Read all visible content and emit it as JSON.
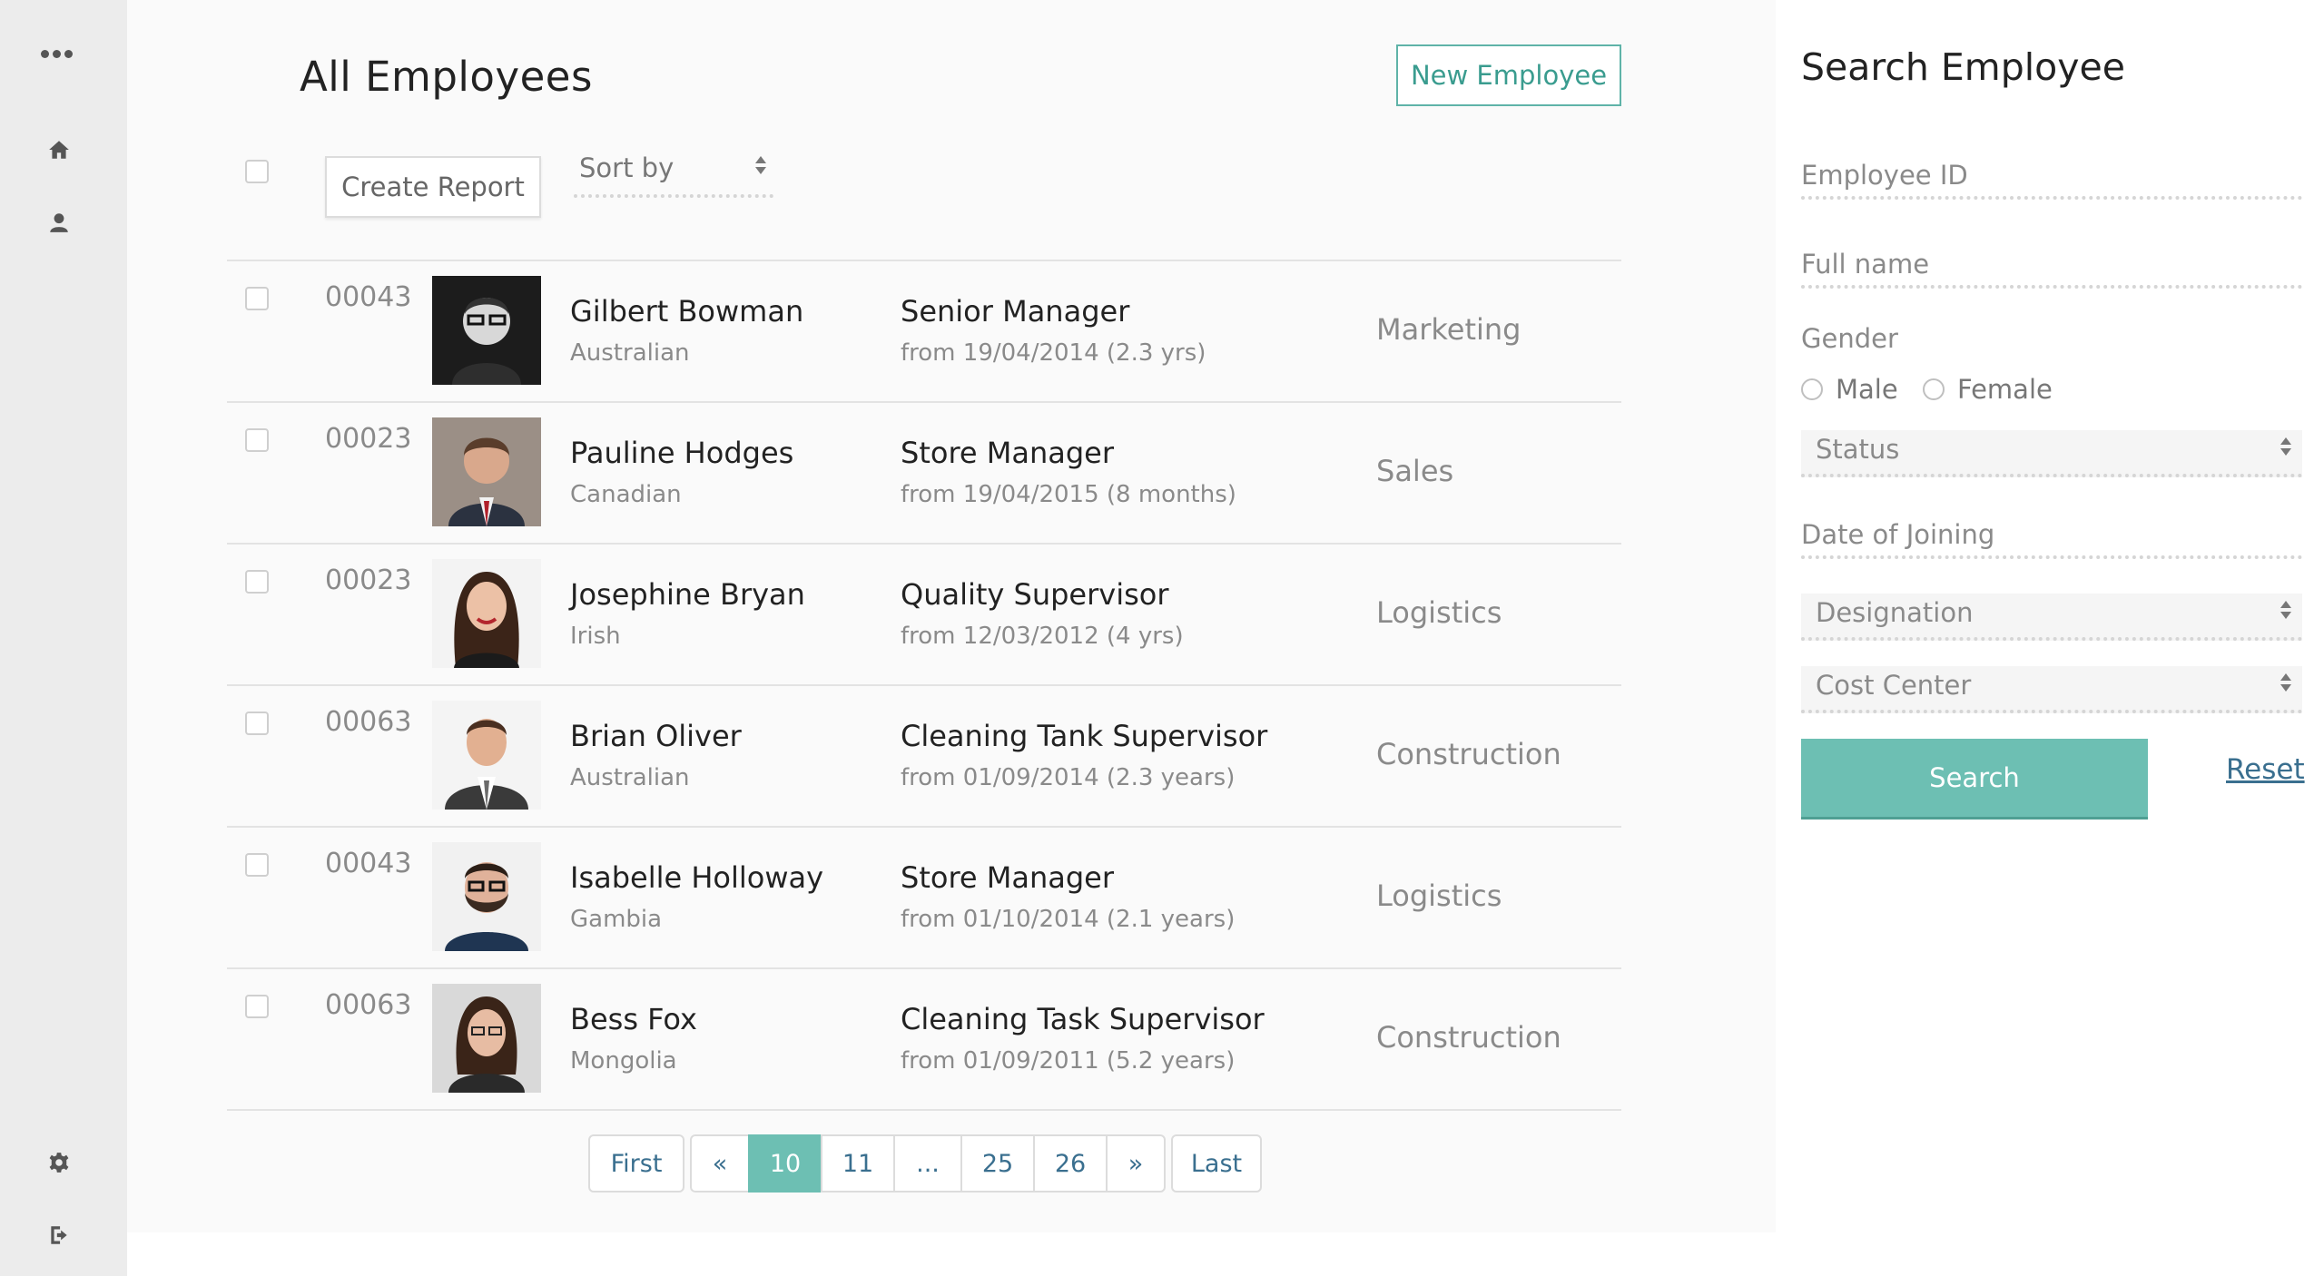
{
  "sidebar": {
    "icons": [
      "more-icon",
      "home-icon",
      "user-icon",
      "gear-icon",
      "logout-icon"
    ]
  },
  "header": {
    "title": "All Employees",
    "new_employee_label": "New Employee",
    "create_report_label": "Create Report",
    "sort_by_label": "Sort by"
  },
  "employees": [
    {
      "id": "00043",
      "name": "Gilbert Bowman",
      "nationality": "Australian",
      "role": "Senior Manager",
      "since": "from 19/04/2014 (2.3 yrs)",
      "department": "Marketing"
    },
    {
      "id": "00023",
      "name": "Pauline Hodges",
      "nationality": "Canadian",
      "role": "Store Manager",
      "since": "from 19/04/2015 (8 months)",
      "department": "Sales"
    },
    {
      "id": "00023",
      "name": "Josephine Bryan",
      "nationality": "Irish",
      "role": "Quality Supervisor",
      "since": "from 12/03/2012 (4 yrs)",
      "department": "Logistics"
    },
    {
      "id": "00063",
      "name": "Brian Oliver",
      "nationality": "Australian",
      "role": "Cleaning Tank Supervisor",
      "since": "from 01/09/2014 (2.3 years)",
      "department": "Construction"
    },
    {
      "id": "00043",
      "name": "Isabelle Holloway",
      "nationality": "Gambia",
      "role": "Store Manager",
      "since": "from 01/10/2014 (2.1 years)",
      "department": "Logistics"
    },
    {
      "id": "00063",
      "name": "Bess Fox",
      "nationality": "Mongolia",
      "role": "Cleaning Task Supervisor",
      "since": "from 01/09/2011 (5.2 years)",
      "department": "Construction"
    }
  ],
  "pagination": {
    "first": "First",
    "prev": "«",
    "pages": [
      "10",
      "11",
      "...",
      "25",
      "26"
    ],
    "current": "10",
    "next": "»",
    "last": "Last"
  },
  "search_panel": {
    "title": "Search Employee",
    "employee_id_placeholder": "Employee ID",
    "full_name_placeholder": "Full name",
    "gender_label": "Gender",
    "gender_options": [
      "Male",
      "Female"
    ],
    "status_label": "Status",
    "date_of_joining_placeholder": "Date of Joining",
    "designation_label": "Designation",
    "cost_center_label": "Cost Center",
    "search_label": "Search",
    "reset_label": "Reset"
  },
  "colors": {
    "accent": "#6dbfb3",
    "accent_border": "#5fb3a8",
    "link": "#3a6f8f",
    "sidebar_bg": "#ececec"
  }
}
